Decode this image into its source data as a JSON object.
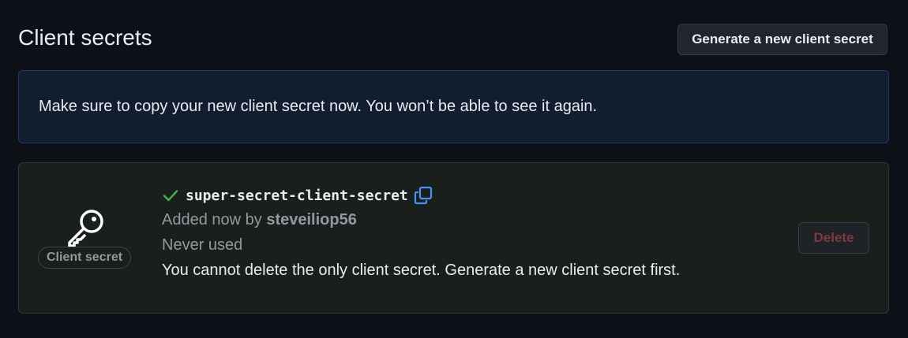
{
  "header": {
    "title": "Client secrets",
    "generate_label": "Generate a new client secret"
  },
  "flash": {
    "message": "Make sure to copy your new client secret now. You won’t be able to see it again."
  },
  "secret": {
    "icon": "key-icon",
    "badge_label": "Client secret",
    "name": "super-secret-client-secret",
    "added_prefix": "Added now by ",
    "added_by": "steveiliop56",
    "usage": "Never used",
    "warning": "You cannot delete the only client secret. Generate a new client secret first.",
    "delete_label": "Delete"
  },
  "colors": {
    "background": "#0d1117",
    "success": "#3fb950",
    "accent": "#4493f8",
    "danger_disabled": "#7d3a3a"
  }
}
